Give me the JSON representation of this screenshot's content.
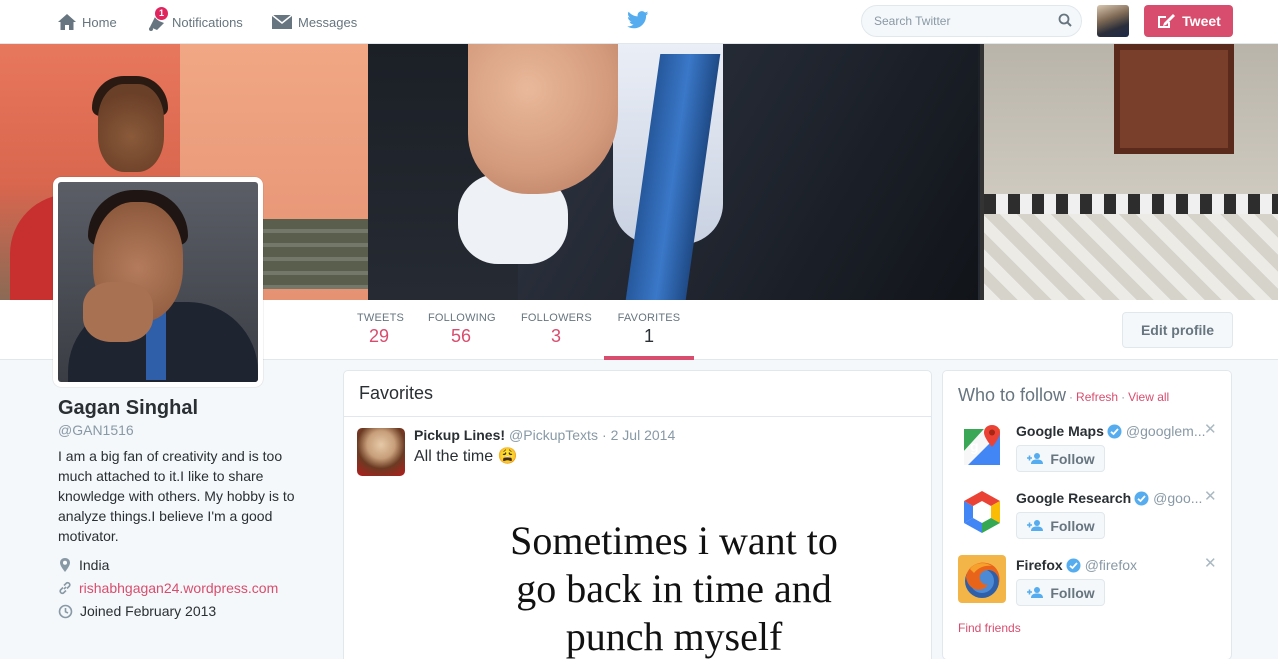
{
  "nav": {
    "home_label": "Home",
    "notifications_label": "Notifications",
    "notifications_count": "1",
    "messages_label": "Messages",
    "search_placeholder": "Search Twitter",
    "tweet_label": "Tweet"
  },
  "colors": {
    "accent": "#d84d6e",
    "twitter_blue": "#55acee",
    "verified": "#55acee"
  },
  "stats": {
    "tweets_label": "TWEETS",
    "tweets_value": "29",
    "following_label": "FOLLOWING",
    "following_value": "56",
    "followers_label": "FOLLOWERS",
    "followers_value": "3",
    "favorites_label": "FAVORITES",
    "favorites_value": "1",
    "edit_profile_label": "Edit profile"
  },
  "profile": {
    "name": "Gagan Singhal",
    "handle": "@GAN1516",
    "bio": "I am a big fan of creativity and is too much attached to it.I like to share knowledge with others. My hobby is to analyze things.I believe I'm a good motivator.",
    "location": "India",
    "website": "rishabhgagan24.wordpress.com",
    "joined": "Joined February 2013"
  },
  "timeline": {
    "title": "Favorites",
    "tweet": {
      "name": "Pickup Lines!",
      "handle": "@PickupTexts",
      "separator": "·",
      "time": "2 Jul 2014",
      "text": "All the time 😩",
      "media_lines": [
        "Sometimes i want to",
        "go back in time and",
        "punch myself"
      ]
    }
  },
  "who_to_follow": {
    "title": "Who to follow",
    "sep": "·",
    "refresh_label": "Refresh",
    "view_all_label": "View all",
    "follow_label": "Follow",
    "find_friends_label": "Find friends",
    "suggestions": [
      {
        "name": "Google Maps",
        "handle": "@googlem...",
        "icon": "google-maps-logo"
      },
      {
        "name": "Google Research",
        "handle": "@goo...",
        "icon": "google-research-logo"
      },
      {
        "name": "Firefox",
        "handle": "@firefox",
        "icon": "firefox-logo"
      }
    ]
  }
}
